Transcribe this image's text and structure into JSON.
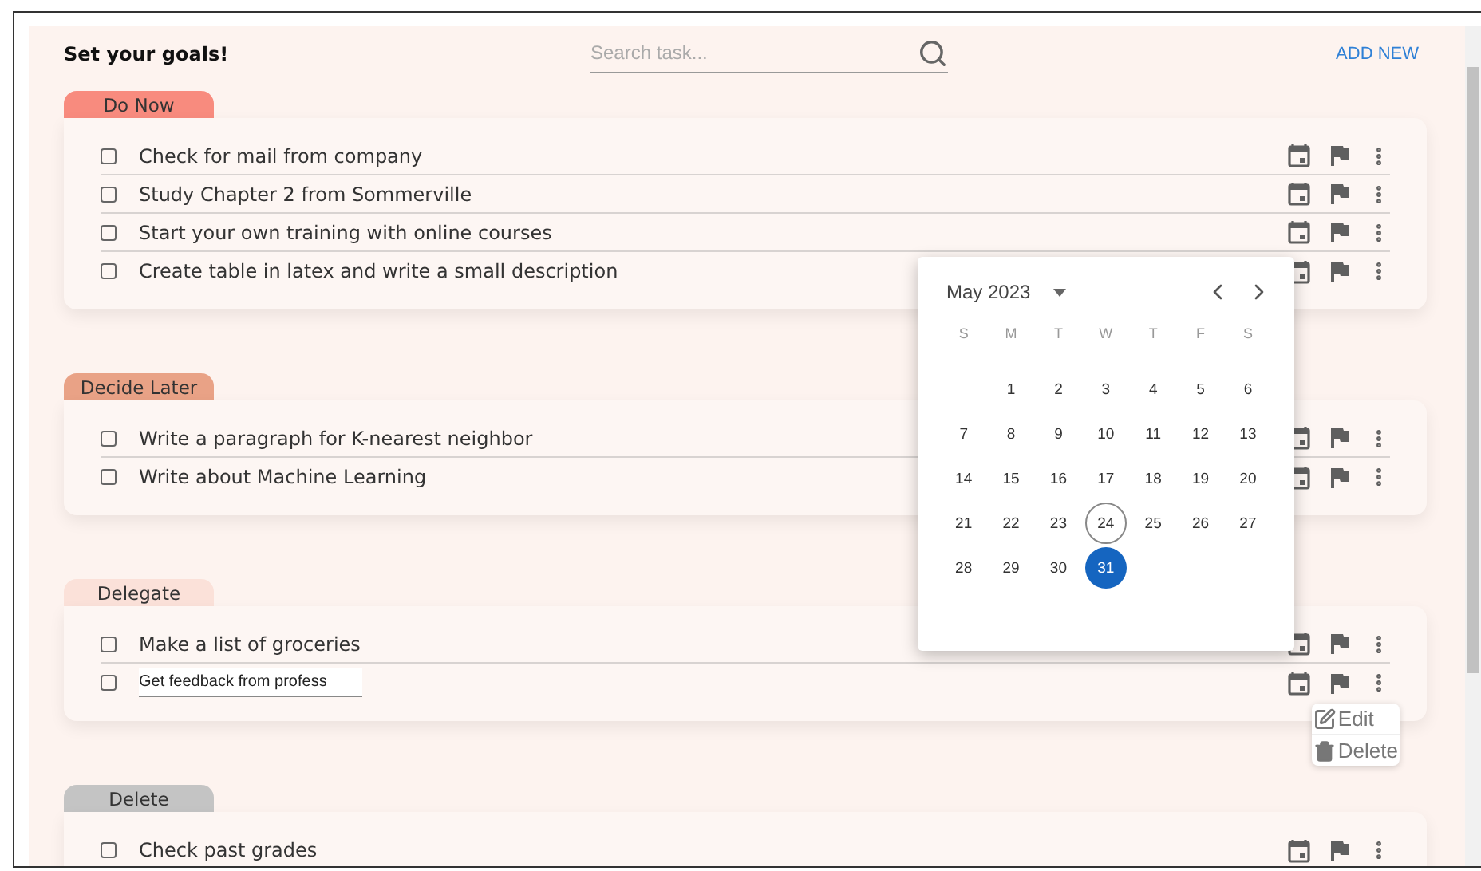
{
  "header": {
    "title": "Set your goals!",
    "search": {
      "placeholder": "Search task..."
    },
    "add_button": "ADD NEW"
  },
  "sections": [
    {
      "label": "Do Now",
      "color": "#f88b7e",
      "tasks": [
        {
          "kind": "text",
          "text": "Check for mail from company",
          "checked": false
        },
        {
          "kind": "text",
          "text": "Study Chapter 2 from Sommerville",
          "checked": false
        },
        {
          "kind": "text",
          "text": "Start your own training with online courses",
          "checked": false
        },
        {
          "kind": "text",
          "text": "Create table in latex and write a small description",
          "checked": false
        }
      ]
    },
    {
      "label": "Decide Later",
      "color": "#e9a286",
      "tasks": [
        {
          "kind": "text",
          "text": "Write a paragraph for K-nearest neighbor",
          "checked": false
        },
        {
          "kind": "text",
          "text": "Write about Machine Learning",
          "checked": false
        }
      ]
    },
    {
      "label": "Delegate",
      "color": "#fbe1d9",
      "tasks": [
        {
          "kind": "text",
          "text": "Make a list of groceries",
          "checked": false
        },
        {
          "kind": "editing",
          "value": "Get feedback from profess",
          "checked": false,
          "menu": [
            {
              "kind": "edit",
              "label": "Edit"
            },
            {
              "kind": "delete",
              "label": "Delete"
            }
          ]
        }
      ]
    },
    {
      "label": "Delete",
      "color": "#c4c4c4",
      "tasks": [
        {
          "kind": "text",
          "text": "Check past grades",
          "checked": false
        }
      ]
    }
  ],
  "date_picker": {
    "month": "May 2023",
    "weekdays": [
      "S",
      "M",
      "T",
      "W",
      "T",
      "F",
      "S"
    ],
    "weeks": [
      {
        "kind": "leading",
        "days": [
          {
            "label": "1",
            "selected": false,
            "today": false
          },
          {
            "label": "2",
            "selected": false,
            "today": false
          },
          {
            "label": "3",
            "selected": false,
            "today": false
          },
          {
            "label": "4",
            "selected": false,
            "today": false
          },
          {
            "label": "5",
            "selected": false,
            "today": false
          },
          {
            "label": "6",
            "selected": false,
            "today": false
          }
        ]
      },
      {
        "kind": "full",
        "days": [
          {
            "label": "7",
            "selected": false,
            "today": false
          },
          {
            "label": "8",
            "selected": false,
            "today": false
          },
          {
            "label": "9",
            "selected": false,
            "today": false
          },
          {
            "label": "10",
            "selected": false,
            "today": false
          },
          {
            "label": "11",
            "selected": false,
            "today": false
          },
          {
            "label": "12",
            "selected": false,
            "today": false
          },
          {
            "label": "13",
            "selected": false,
            "today": false
          }
        ]
      },
      {
        "kind": "full",
        "days": [
          {
            "label": "14",
            "selected": false,
            "today": false
          },
          {
            "label": "15",
            "selected": false,
            "today": false
          },
          {
            "label": "16",
            "selected": false,
            "today": false
          },
          {
            "label": "17",
            "selected": false,
            "today": false
          },
          {
            "label": "18",
            "selected": false,
            "today": false
          },
          {
            "label": "19",
            "selected": false,
            "today": false
          },
          {
            "label": "20",
            "selected": false,
            "today": false
          }
        ]
      },
      {
        "kind": "full",
        "days": [
          {
            "label": "21",
            "selected": false,
            "today": false
          },
          {
            "label": "22",
            "selected": false,
            "today": false
          },
          {
            "label": "23",
            "selected": false,
            "today": false
          },
          {
            "label": "24",
            "selected": false,
            "today": true
          },
          {
            "label": "25",
            "selected": false,
            "today": false
          },
          {
            "label": "26",
            "selected": false,
            "today": false
          },
          {
            "label": "27",
            "selected": false,
            "today": false
          }
        ]
      },
      {
        "kind": "trailing",
        "days": [
          {
            "label": "28",
            "selected": false,
            "today": false
          },
          {
            "label": "29",
            "selected": false,
            "today": false
          },
          {
            "label": "30",
            "selected": false,
            "today": false
          },
          {
            "label": "31",
            "selected": true,
            "today": false
          }
        ]
      }
    ]
  }
}
